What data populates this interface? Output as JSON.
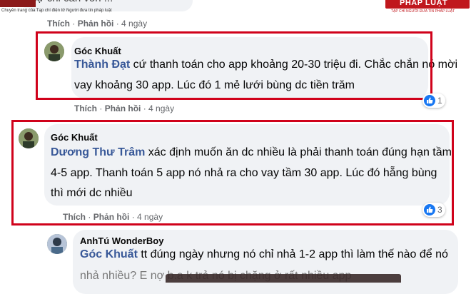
{
  "header": {
    "cut_text": "cự chỉ cần vốn ...",
    "caption": "Chuyên trang của Tạp chí điện tử Người đưa tin pháp luật",
    "logo": "PHÁP LUẬT",
    "logo_sub": "TẠP CHÍ NGƯỜI ĐƯA TIN PHÁP LUẬT"
  },
  "comments": [
    {
      "id": "c0",
      "actions": {
        "like": "Thích",
        "reply": "Phản hồi",
        "time": "4 ngày"
      }
    },
    {
      "id": "c1",
      "author": "Góc Khuất",
      "mention": "Thành Đạt",
      "line1": " cứ thanh toán cho app khoảng 20-30 triệu đi. Chắc chắn nó mời",
      "line2": "vay khoảng 30 app. Lúc đó 1 mẻ lưới bùng dc tiền trăm",
      "reaction_count": "1",
      "actions": {
        "like": "Thích",
        "reply": "Phản hồi",
        "time": "4 ngày"
      }
    },
    {
      "id": "c2",
      "author": "Góc Khuất",
      "mention": "Dương Thư Trâm",
      "line1": " xác định muốn ăn dc nhiều là phải thanh toán đúng hạn tầm",
      "line2": "4-5 app. Thanh toán 5 app nó nhả ra cho vay tầm 30 app. Lúc đó hẵng bùng",
      "line3": "thì mới dc nhiều",
      "reaction_count": "3",
      "actions": {
        "like": "Thích",
        "reply": "Phản hồi",
        "time": "4 ngày"
      }
    },
    {
      "id": "c3",
      "author": "AnhTú WonderBoy",
      "mention": "Góc Khuất",
      "line1": " tt đúng ngày nhưng nó chỉ nhả 1-2 app thì làm thế nào để nó",
      "line2_partial": "nhả nhiều? E nợ b.a k trả nó bị chặng ở rất nhiều app"
    }
  ],
  "colors": {
    "frame": "#d0021b",
    "bubble": "#f0f2f5",
    "mention": "#385898",
    "like_blue": "#1877f2",
    "meta": "#65676b"
  }
}
